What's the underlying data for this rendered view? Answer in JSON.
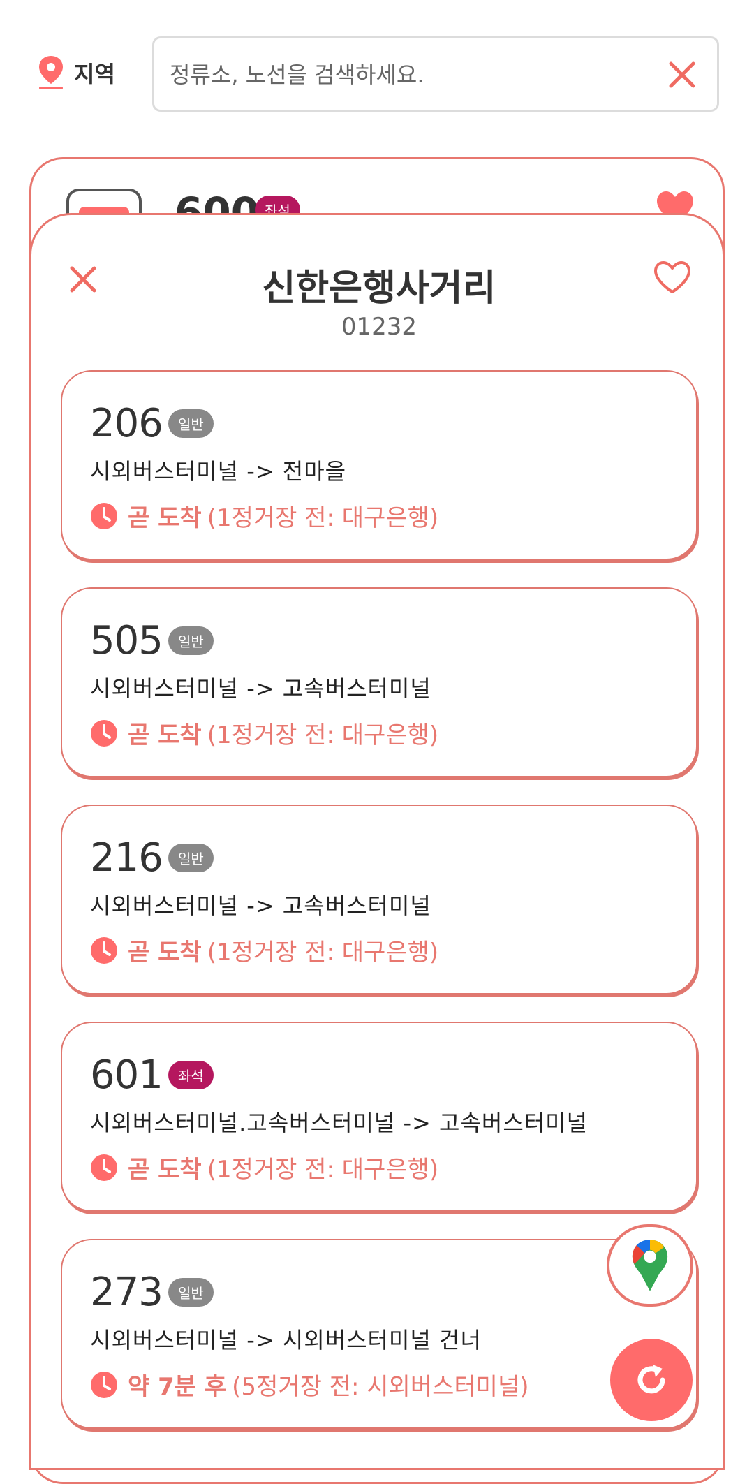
{
  "header": {
    "region_label": "지역",
    "search_placeholder": "정류소, 노선을 검색하세요."
  },
  "background_card": {
    "route": "600",
    "badge": "좌석"
  },
  "stop": {
    "name": "신한은행사거리",
    "id": "01232"
  },
  "buses": [
    {
      "route": "206",
      "type": "일반",
      "direction": "시외버스터미널 -> 전마을",
      "eta": "곧 도착",
      "detail": "(1정거장 전: 대구은행)"
    },
    {
      "route": "505",
      "type": "일반",
      "direction": "시외버스터미널 -> 고속버스터미널",
      "eta": "곧 도착",
      "detail": "(1정거장 전: 대구은행)"
    },
    {
      "route": "216",
      "type": "일반",
      "direction": "시외버스터미널 -> 고속버스터미널",
      "eta": "곧 도착",
      "detail": "(1정거장 전: 대구은행)"
    },
    {
      "route": "601",
      "type": "좌석",
      "direction": "시외버스터미널.고속버스터미널 -> 고속버스터미널",
      "eta": "곧 도착",
      "detail": "(1정거장 전: 대구은행)"
    },
    {
      "route": "273",
      "type": "일반",
      "direction": "시외버스터미널 -> 시외버스터미널 건너",
      "eta": "약 7분 후",
      "detail": "(5정거장 전: 시외버스터미널)"
    }
  ],
  "colors": {
    "accent": "#e8776f",
    "normal_badge": "#888888",
    "seat_badge": "#b5175e",
    "refresh": "#ff6b6b"
  },
  "icons": [
    "location-pin-icon",
    "close-icon",
    "heart-icon",
    "clock-icon",
    "google-maps-icon",
    "refresh-icon"
  ]
}
